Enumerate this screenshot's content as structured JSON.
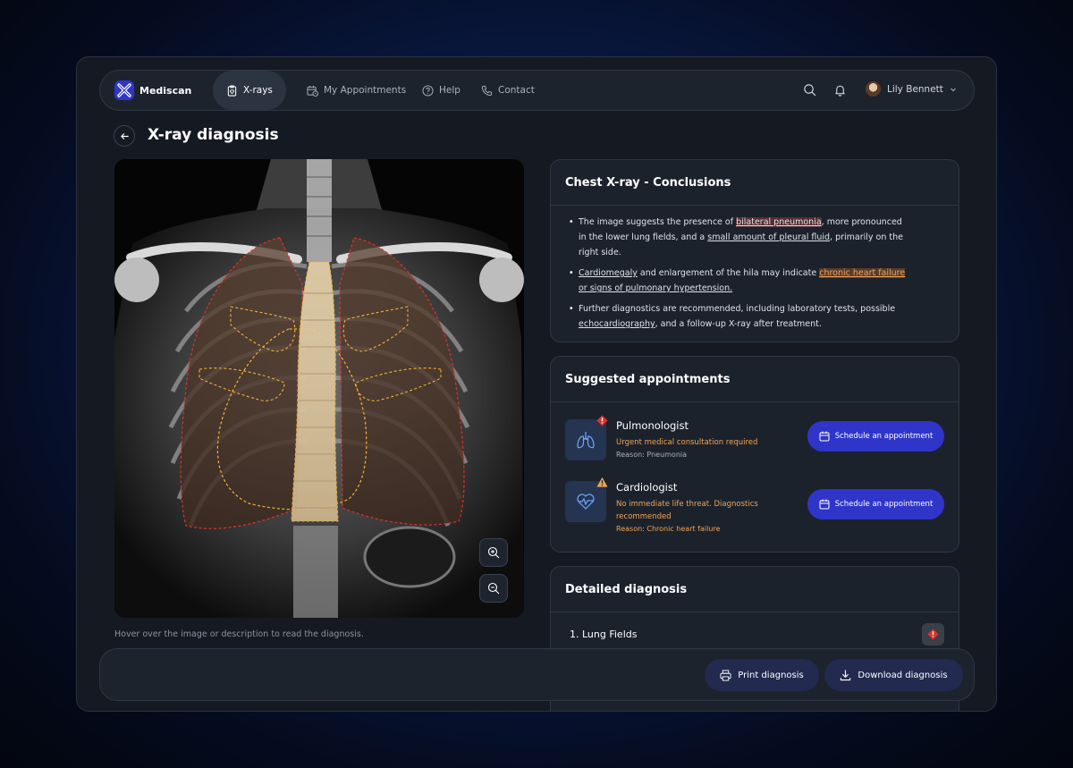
{
  "app": {
    "name": "Mediscan"
  },
  "nav": {
    "items": [
      {
        "label": "X-rays",
        "icon": "clipboard-heart-icon",
        "active": true
      },
      {
        "label": "My Appointments",
        "icon": "calendar-clock-icon",
        "active": false
      },
      {
        "label": "Help",
        "icon": "question-circle-icon",
        "active": false
      },
      {
        "label": "Contact",
        "icon": "phone-icon",
        "active": false
      }
    ],
    "user_name": "Lily Bennett"
  },
  "page": {
    "title": "X-ray diagnosis"
  },
  "xray": {
    "hint": "Hover over the image or description to read the diagnosis.",
    "overlay_colors": {
      "lungs": "#e0312c",
      "heart": "#f5b232",
      "spine": "#f3e2b8"
    }
  },
  "conclusions": {
    "title": "Chest X-ray - Conclusions",
    "bullets": [
      {
        "parts": [
          "The image suggests the presence of ",
          "bilateral pneumonia",
          ", more pronounced in the lower lung fields, and a ",
          "small amount of pleural fluid",
          ", primarily on the right side."
        ]
      },
      {
        "parts": [
          "Cardiomegaly",
          " and enlargement of the hila may indicate ",
          "chronic heart failure",
          " ",
          "or signs of pulmonary hypertension."
        ]
      },
      {
        "parts": [
          "Further diagnostics are recommended, including laboratory tests, possible ",
          "echocardiography",
          ", and a follow-up X-ray after treatment."
        ]
      }
    ]
  },
  "appointments": {
    "title": "Suggested appointments",
    "items": [
      {
        "name": "Pulmonologist",
        "status": "Urgent medical consultation required",
        "reason": "Reason: Pneumonia",
        "button": "Schedule an appointment",
        "icon": "lungs-icon",
        "badge": "urgent-diamond-icon",
        "reason_color": "#a9b1bf"
      },
      {
        "name": "Cardiologist",
        "status": "No immediate life threat. Diagnostics recommended",
        "reason": "Reason: Chronic heart failure",
        "button": "Schedule an appointment",
        "icon": "heart-pulse-icon",
        "badge": "warning-triangle-icon",
        "reason_color": "#f0a554"
      }
    ]
  },
  "detailed": {
    "title": "Detailed diagnosis",
    "items": [
      {
        "label": "1. Lung Fields"
      }
    ]
  },
  "actions": {
    "print": "Print diagnosis",
    "download": "Download diagnosis"
  },
  "colors": {
    "accent": "#2f35c9",
    "warning": "#f0a554",
    "danger": "#e0312c"
  }
}
